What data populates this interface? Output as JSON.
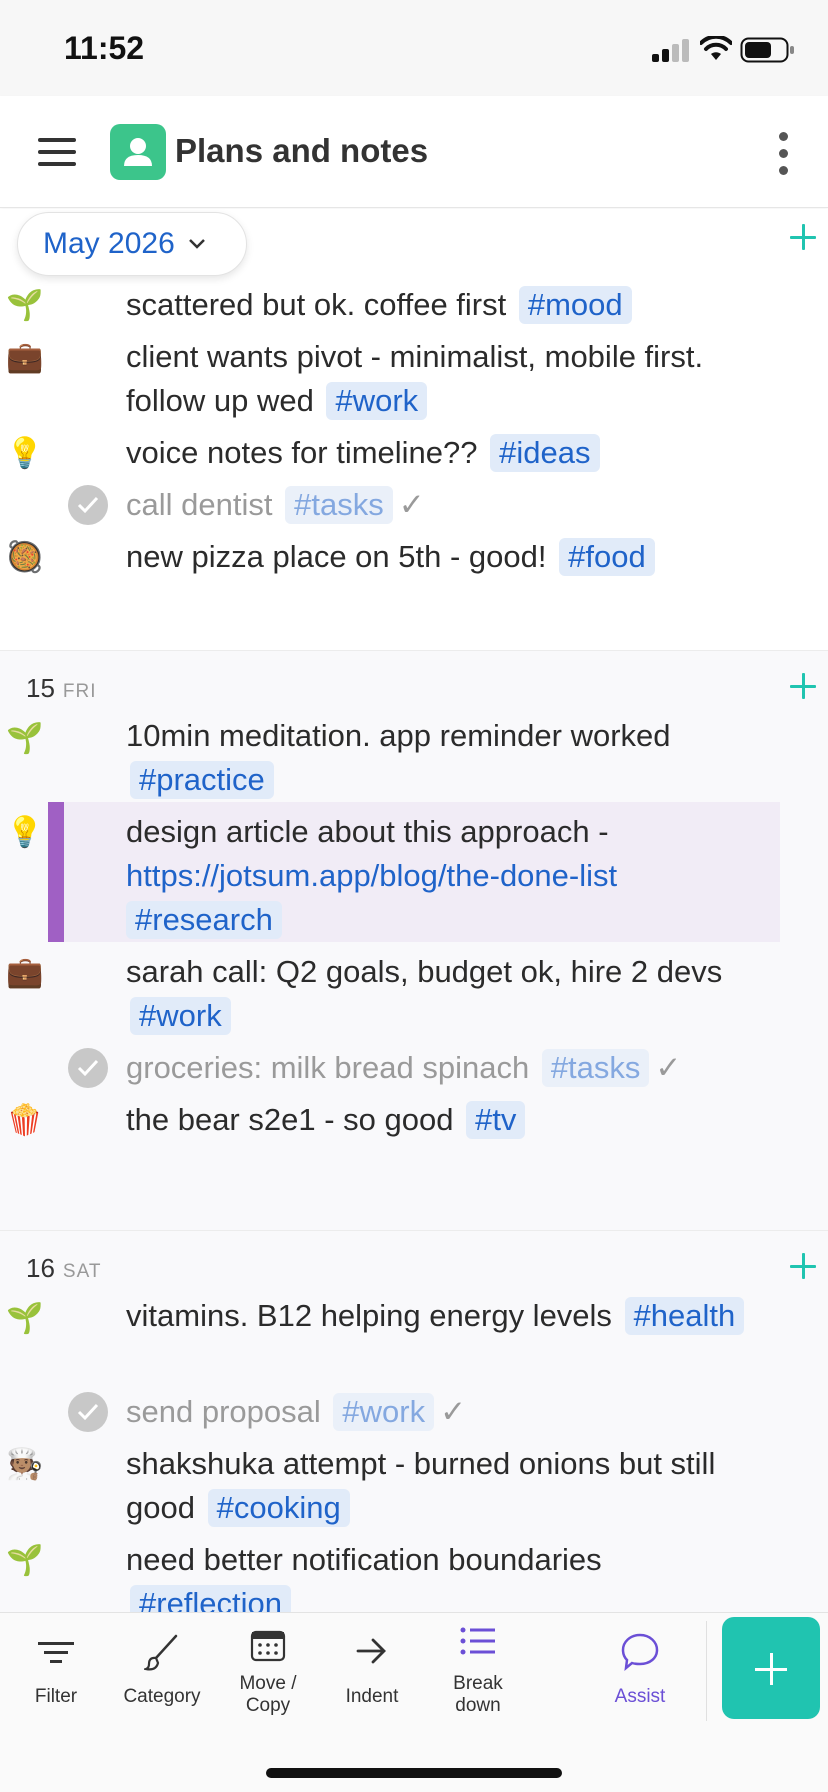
{
  "status_bar": {
    "time": "11:52"
  },
  "header": {
    "title": "Plans and notes"
  },
  "month_selector": {
    "label": "May 2026"
  },
  "days": [
    {
      "entries": [
        {
          "icon": "🌱",
          "text": "scattered but ok. coffee first",
          "tag": "#mood"
        },
        {
          "icon": "💼",
          "text": "client wants pivot - minimalist, mobile first. follow up wed",
          "tag": "#work"
        },
        {
          "icon": "💡",
          "text": "voice notes for timeline??",
          "tag": "#ideas"
        },
        {
          "text": "call dentist",
          "tag": "#tasks",
          "done_mark": "✓"
        },
        {
          "icon": "🥘",
          "text": "new pizza place on 5th - good!",
          "tag": "#food"
        }
      ]
    },
    {
      "day": "15",
      "weekday": "FRI",
      "entries": [
        {
          "icon": "🌱",
          "text": "10min meditation. app reminder worked",
          "tag": "#practice"
        },
        {
          "icon": "💡",
          "text": "design article about this approach -",
          "url": "https://jotsum.app/blog/the-done-list",
          "tag": "#research"
        },
        {
          "icon": "💼",
          "text": "sarah call: Q2 goals, budget ok, hire 2 devs",
          "tag": "#work"
        },
        {
          "text": "groceries: milk bread spinach",
          "tag": "#tasks",
          "done_mark": "✓"
        },
        {
          "icon": "🍿",
          "text": "the bear s2e1 - so good",
          "tag": "#tv"
        }
      ]
    },
    {
      "day": "16",
      "weekday": "SAT",
      "entries": [
        {
          "icon": "🌱",
          "text": "vitamins. B12 helping energy levels",
          "tag": "#health"
        },
        {
          "text": "send proposal",
          "tag": "#work",
          "done_mark": "✓"
        },
        {
          "icon": "🧑🏽‍🍳",
          "text": "shakshuka attempt - burned onions but still good",
          "tag": "#cooking"
        },
        {
          "icon": "🌱",
          "text": "need better notification boundaries",
          "tag": "#reflection"
        }
      ]
    }
  ],
  "toolbar": {
    "filter": "Filter",
    "category": "Category",
    "move_copy_1": "Move /",
    "move_copy_2": "Copy",
    "indent": "Indent",
    "break_down_1": "Break",
    "break_down_2": "down",
    "assist": "Assist"
  },
  "colors": {
    "accent_teal": "#20c4b0",
    "link_blue": "#1f63c9",
    "highlight_purple": "#a060c4",
    "assist_purple": "#6b4fd6",
    "app_green": "#3cc58b"
  }
}
